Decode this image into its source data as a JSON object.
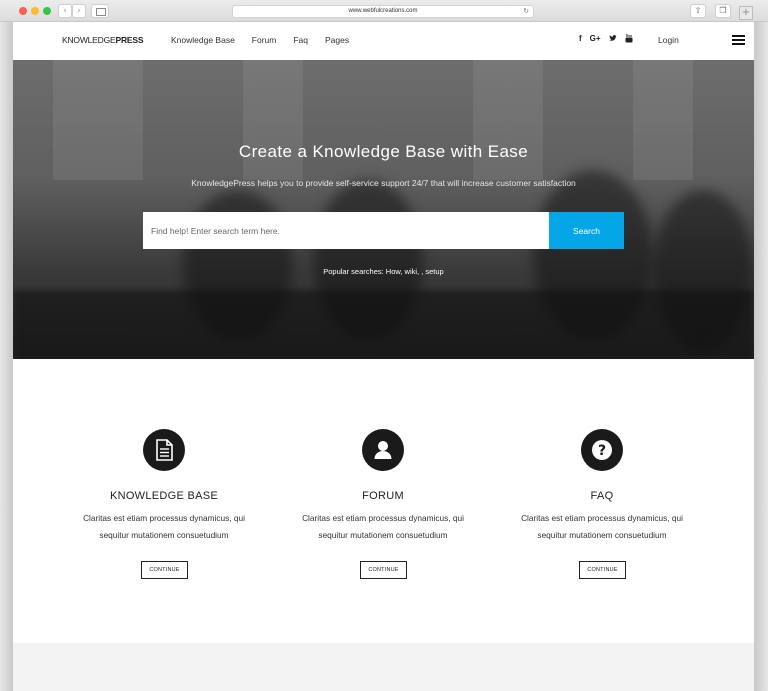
{
  "browser": {
    "url": "www.webfulcreations.com",
    "back_glyph": "‹",
    "forward_glyph": "›",
    "reload_glyph": "↻",
    "share_glyph": "⇧",
    "tabs_glyph": "❐",
    "newtab_glyph": "+"
  },
  "header": {
    "logo_light": "KNOWLEDGE",
    "logo_bold": "PRESS",
    "nav": [
      "Knowledge Base",
      "Forum",
      "Faq",
      "Pages"
    ],
    "social": [
      {
        "icon": "facebook-icon",
        "glyph": "f"
      },
      {
        "icon": "google-plus-icon",
        "glyph": "G+"
      },
      {
        "icon": "twitter-icon",
        "glyph": "🐦"
      },
      {
        "icon": "youtube-icon",
        "glyph": "▶"
      }
    ],
    "login": "Login"
  },
  "hero": {
    "title": "Create a Knowledge Base with Ease",
    "subtitle": "KnowledgePress helps you to provide self-service support 24/7 that will increase customer satisfaction",
    "search_placeholder": "Find help! Enter search term here.",
    "search_button": "Search",
    "popular": "Popular searches: How, wiki, , setup"
  },
  "features": [
    {
      "title": "KNOWLEDGE BASE",
      "desc1": "Claritas est etiam processus dynamicus, qui",
      "desc2": "sequitur mutationem consuetudium",
      "button": "CONTINUE",
      "icon": "document-icon"
    },
    {
      "title": "FORUM",
      "desc1": "Claritas est etiam processus dynamicus, qui",
      "desc2": "sequitur mutationem consuetudium",
      "button": "CONTINUE",
      "icon": "user-icon"
    },
    {
      "title": "FAQ",
      "desc1": "Claritas est etiam processus dynamicus, qui",
      "desc2": "sequitur mutationem consuetudium",
      "button": "CONTINUE",
      "icon": "question-icon"
    }
  ],
  "colors": {
    "accent": "#04a6e8",
    "icon_bg": "#1a1a1a"
  }
}
